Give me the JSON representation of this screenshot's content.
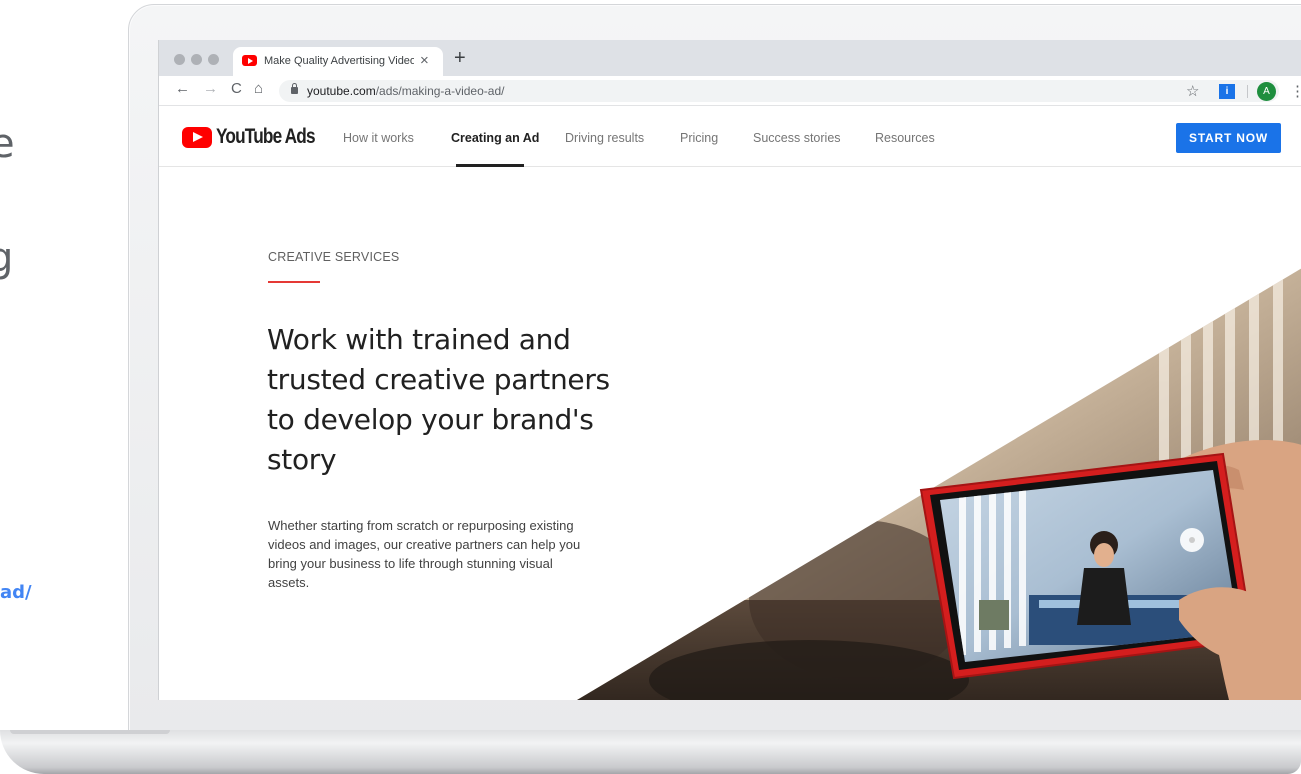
{
  "slide_fragment": {
    "chars": [
      "e",
      "g"
    ],
    "url_fragment": "ad/"
  },
  "browser": {
    "tab_title": "Make Quality Advertising Videos",
    "tab_close": "×",
    "new_tab": "+",
    "back": "←",
    "forward": "→",
    "reload": "C",
    "home": "⌂",
    "url_domain": "youtube.com",
    "url_path": "/ads/making-a-video-ad/",
    "bookmark_star": "☆",
    "extension_label": "i",
    "avatar_initial": "A",
    "menu": "⋮"
  },
  "site": {
    "logo_text": "YouTube Ads",
    "nav": [
      {
        "label": "How it works"
      },
      {
        "label": "Creating an Ad",
        "active": true
      },
      {
        "label": "Driving results"
      },
      {
        "label": "Pricing"
      },
      {
        "label": "Success stories"
      },
      {
        "label": "Resources"
      }
    ],
    "cta": "START NOW"
  },
  "hero": {
    "eyebrow": "CREATIVE SERVICES",
    "headline_lines": [
      "Work with trained and",
      "trusted creative partners",
      "to develop your brand's",
      "story"
    ],
    "body_lines": [
      "Whether starting from scratch or repurposing existing",
      "videos and images, our creative partners can help you",
      "bring your business to life through stunning visual",
      "assets."
    ]
  },
  "colors": {
    "brand_red": "#ff0000",
    "accent_red": "#e53935",
    "cta_blue": "#1a73e8",
    "avatar_green": "#1e8e3e",
    "phone_case_red": "#d41e1e",
    "link_blue": "#4285f4"
  }
}
